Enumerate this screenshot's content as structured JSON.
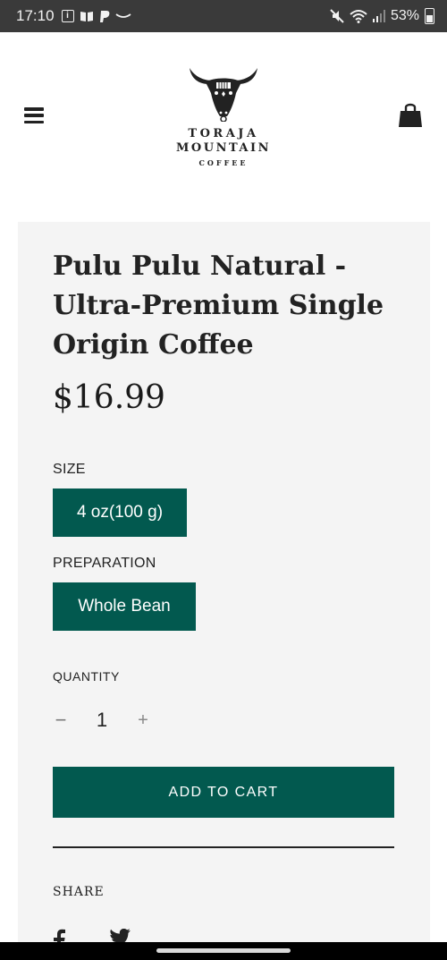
{
  "status_bar": {
    "time": "17:10",
    "battery": "53%",
    "icons_left": [
      "info-icon",
      "book-icon",
      "paypal-icon",
      "amazon-icon"
    ],
    "icons_right": [
      "mute-icon",
      "wifi-icon",
      "signal-icon",
      "battery-icon"
    ]
  },
  "header": {
    "logo_line1": "TORAJA",
    "logo_line2": "MOUNTAIN",
    "logo_line3": "COFFEE"
  },
  "product": {
    "title": "Pulu Pulu Natural - Ultra-Premium Single Origin Coffee",
    "price": "$16.99",
    "size_label": "SIZE",
    "size_value": "4 oz(100 g)",
    "preparation_label": "PREPARATION",
    "preparation_value": "Whole Bean",
    "quantity_label": "QUANTITY",
    "quantity_minus": "−",
    "quantity_value": "1",
    "quantity_plus": "+",
    "add_to_cart": "ADD TO CART",
    "share_label": "SHARE"
  },
  "colors": {
    "accent": "#02594f",
    "panel_bg": "#f4f4f4",
    "status_bar_bg": "#3a3a3a"
  }
}
